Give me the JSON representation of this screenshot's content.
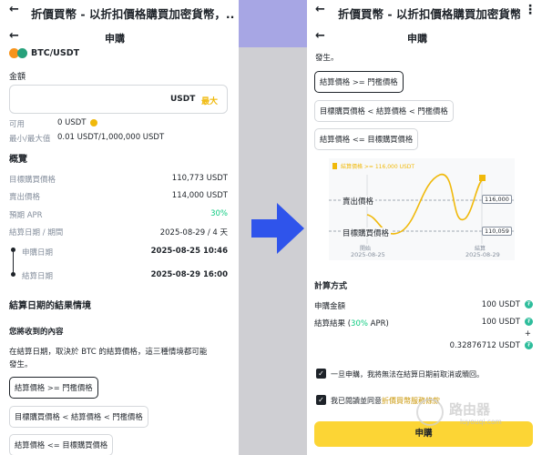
{
  "left": {
    "app_title": "折價買幣 - 以折扣價格購買加密貨幣，...",
    "page_title": "申購",
    "pair": "BTC/USDT",
    "amount_label": "金額",
    "amount_unit": "USDT",
    "max_label": "最大",
    "available_label": "可用",
    "available_value": "0 USDT",
    "minmax_label": "最小/最大值",
    "minmax_value": "0.01 USDT/1,000,000 USDT",
    "overview_title": "概覽",
    "overview_rows": [
      {
        "label": "目標購買價格",
        "value": "110,773 USDT"
      },
      {
        "label": "賣出價格",
        "value": "114,000 USDT"
      },
      {
        "label": "預期 APR",
        "value": "30%"
      },
      {
        "label": "結算日期 / 期間",
        "value": "2025-08-29 / 4 天"
      }
    ],
    "timeline": [
      {
        "label": "申購日期",
        "value": "2025-08-25 10:46"
      },
      {
        "label": "結算日期",
        "value": "2025-08-29 16:00"
      }
    ],
    "result_title": "結算日期的結果情境",
    "receive_title": "您將收到的內容",
    "desc_line1": "在結算日期，取決於 BTC 的結算價格，這三種情境都可能",
    "desc_line2": "發生。",
    "scenarios": [
      "結算價格 >= 門檻價格",
      "目標購買價格 < 結算價格 < 門檻價格",
      "結算價格 <= 目標購買價格"
    ]
  },
  "right": {
    "app_title": "折價買幣 - 以折扣價格購買加密貨幣，...",
    "page_title": "申購",
    "top_text": "發生。",
    "scenarios": [
      "結算價格 >= 門檻價格",
      "目標購買價格 < 結算價格 < 門檻價格",
      "結算價格 <= 目標購買價格"
    ],
    "chart_badge": "結算價格 >= 116,000 USDT",
    "sell_label": "賣出價格",
    "sell_value": "116,000",
    "buy_label": "目標購買價格",
    "buy_value": "110,059",
    "start_label": "開始",
    "start_date": "2025-08-25",
    "settle_label": "結算",
    "settle_date": "2025-08-29",
    "calc_title": "計算方式",
    "sub_amount_label": "申購金額",
    "sub_amount_value": "100 USDT",
    "result_label_prefix": "結算結果 (",
    "result_apr": "30%",
    "result_label_suffix": " APR)",
    "result_value1": "100 USDT",
    "plus_sign": "+",
    "result_value2": "0.32876712 USDT",
    "check1": "一旦申購，我將無法在結算日期前取消或贖回。",
    "check2_prefix": "我已閱讀並同意",
    "check2_link": "折價買幣服務條款",
    "subscribe_label": "申購",
    "watermark_name": "路由器",
    "watermark_url": "luyouqi.com"
  },
  "colors": {
    "accent_yellow": "#fcd535",
    "max_yellow": "#f0b90b",
    "green": "#0ecb81",
    "arrow_blue": "#2f54eb",
    "chart_line": "#f0b90b"
  }
}
